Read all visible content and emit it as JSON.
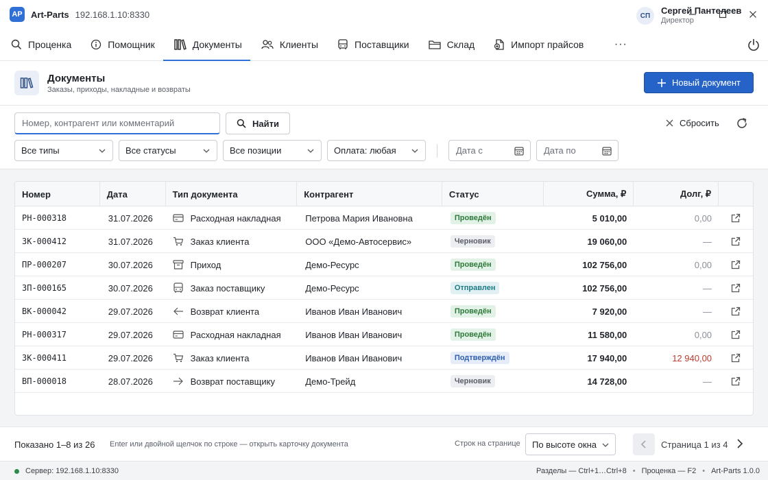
{
  "app": {
    "logo": "AP",
    "title": "Art-Parts",
    "address": "192.168.1.10:8330"
  },
  "nav": {
    "items": [
      {
        "label": "Проценка",
        "icon": "search-icon"
      },
      {
        "label": "Помощник",
        "icon": "info-icon"
      },
      {
        "label": "Документы",
        "icon": "books-icon",
        "active": true
      },
      {
        "label": "Клиенты",
        "icon": "users-icon"
      },
      {
        "label": "Поставщики",
        "icon": "bus-icon"
      },
      {
        "label": "Склад",
        "icon": "folder-icon"
      },
      {
        "label": "Импорт прайсов",
        "icon": "file-import-icon"
      }
    ],
    "more": "···"
  },
  "user": {
    "initials": "СП",
    "name": "Сергей Пантелеев",
    "role": "Директор"
  },
  "page": {
    "title": "Документы",
    "subtitle": "Заказы, приходы, накладные и возвраты",
    "new_button": "Новый документ"
  },
  "filters": {
    "search_placeholder": "Номер, контрагент или комментарий",
    "find_label": "Найти",
    "reset_label": "Сбросить",
    "type": "Все типы",
    "status": "Все статусы",
    "position": "Все позиции",
    "payment": "Оплата: любая",
    "date_from": "Дата с",
    "date_to": "Дата по"
  },
  "table": {
    "headers": {
      "number": "Номер",
      "date": "Дата",
      "type": "Тип документа",
      "counterparty": "Контрагент",
      "status": "Статус",
      "sum": "Сумма, ₽",
      "debt": "Долг, ₽"
    },
    "rows": [
      {
        "number": "РН-000318",
        "date": "31.07.2026",
        "type": "Расходная накладная",
        "type_icon": "card-icon",
        "counterparty": "Петрова Мария Ивановна",
        "status": "Проведён",
        "status_color": "green",
        "sum": "5 010,00",
        "debt": "0,00",
        "debt_red": false
      },
      {
        "number": "ЗК-000412",
        "date": "31.07.2026",
        "type": "Заказ клиента",
        "type_icon": "cart-icon",
        "counterparty": "ООО «Демо-Автосервис»",
        "status": "Черновик",
        "status_color": "gray",
        "sum": "19 060,00",
        "debt": "—",
        "debt_red": false
      },
      {
        "number": "ПР-000207",
        "date": "30.07.2026",
        "type": "Приход",
        "type_icon": "archive-icon",
        "counterparty": "Демо-Ресурс",
        "status": "Проведён",
        "status_color": "green",
        "sum": "102 756,00",
        "debt": "0,00",
        "debt_red": false
      },
      {
        "number": "ЗП-000165",
        "date": "30.07.2026",
        "type": "Заказ поставщику",
        "type_icon": "bus-icon",
        "counterparty": "Демо-Ресурс",
        "status": "Отправлен",
        "status_color": "teal",
        "sum": "102 756,00",
        "debt": "—",
        "debt_red": false
      },
      {
        "number": "ВК-000042",
        "date": "29.07.2026",
        "type": "Возврат клиента",
        "type_icon": "arrow-left-icon",
        "counterparty": "Иванов Иван Иванович",
        "status": "Проведён",
        "status_color": "green",
        "sum": "7 920,00",
        "debt": "—",
        "debt_red": false
      },
      {
        "number": "РН-000317",
        "date": "29.07.2026",
        "type": "Расходная накладная",
        "type_icon": "card-icon",
        "counterparty": "Иванов Иван Иванович",
        "status": "Проведён",
        "status_color": "green",
        "sum": "11 580,00",
        "debt": "0,00",
        "debt_red": false
      },
      {
        "number": "ЗК-000411",
        "date": "29.07.2026",
        "type": "Заказ клиента",
        "type_icon": "cart-icon",
        "counterparty": "Иванов Иван Иванович",
        "status": "Подтверждён",
        "status_color": "blue",
        "sum": "17 940,00",
        "debt": "12 940,00",
        "debt_red": true
      },
      {
        "number": "ВП-000018",
        "date": "28.07.2026",
        "type": "Возврат поставщику",
        "type_icon": "arrow-right-icon",
        "counterparty": "Демо-Трейд",
        "status": "Черновик",
        "status_color": "gray",
        "sum": "14 728,00",
        "debt": "—",
        "debt_red": false
      }
    ]
  },
  "footer": {
    "shown": "Показано 1–8 из 26",
    "hint": "Enter или двойной щелчок по строке — открыть карточку документа",
    "rows_label": "Строк на странице",
    "rows_value": "По высоте окна",
    "page": "Страница 1 из 4"
  },
  "statusbar": {
    "server": "Сервер: 192.168.1.10:8330",
    "shortcut_sections": "Разделы — Ctrl+1…Ctrl+8",
    "shortcut_pricing": "Проценка — F2",
    "version": "Art-Parts 1.0.0"
  },
  "colors": {
    "accent": "#2f6fd6",
    "primary_button": "#2563c9",
    "debt_red": "#c0392b",
    "online": "#2c8a4a"
  }
}
